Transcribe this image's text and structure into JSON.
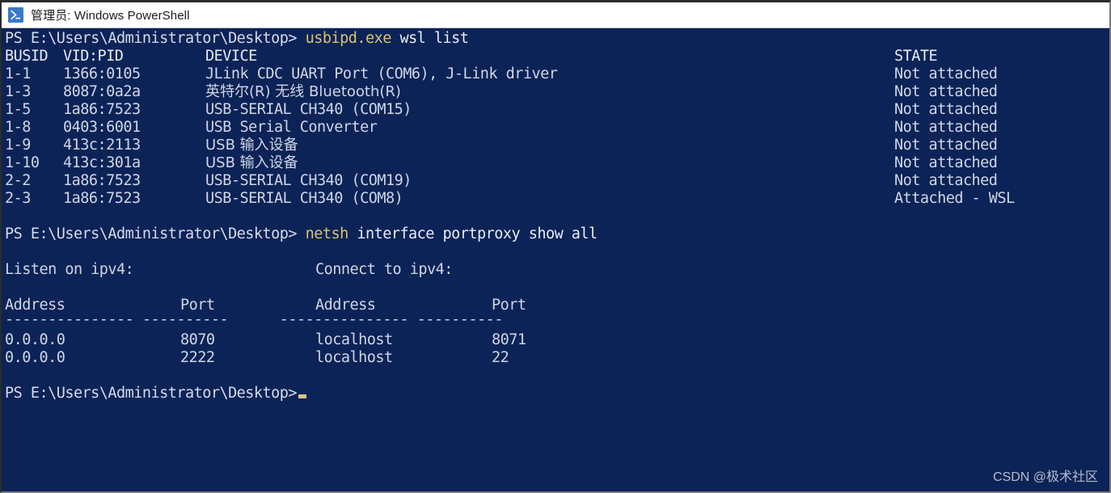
{
  "window": {
    "title": "管理员: Windows PowerShell",
    "icon": "powershell-icon",
    "background_color": "#0c2357",
    "titlebar_color": "#ffffff",
    "text_color": "#d6dbe8",
    "accent_color": "#d9c56a"
  },
  "terminal": {
    "prompt": "PS E:\\Users\\Administrator\\Desktop>",
    "commands": [
      {
        "name": "usbipd.exe",
        "args": " wsl list"
      },
      {
        "name": "netsh",
        "args": " interface portproxy show all"
      }
    ],
    "usbipd_table": {
      "headers": {
        "busid": "BUSID",
        "vidpid": "VID:PID",
        "device": "DEVICE",
        "state": "STATE"
      },
      "rows": [
        {
          "busid": "1-1",
          "vidpid": "1366:0105",
          "device": "JLink CDC UART Port (COM6), J-Link driver",
          "state": "Not attached"
        },
        {
          "busid": "1-3",
          "vidpid": "8087:0a2a",
          "device": "英特尔(R) 无线 Bluetooth(R)",
          "state": "Not attached"
        },
        {
          "busid": "1-5",
          "vidpid": "1a86:7523",
          "device": "USB-SERIAL CH340 (COM15)",
          "state": "Not attached"
        },
        {
          "busid": "1-8",
          "vidpid": "0403:6001",
          "device": "USB Serial Converter",
          "state": "Not attached"
        },
        {
          "busid": "1-9",
          "vidpid": "413c:2113",
          "device": "USB 输入设备",
          "state": "Not attached"
        },
        {
          "busid": "1-10",
          "vidpid": "413c:301a",
          "device": "USB 输入设备",
          "state": "Not attached"
        },
        {
          "busid": "2-2",
          "vidpid": "1a86:7523",
          "device": "USB-SERIAL CH340 (COM19)",
          "state": "Not attached"
        },
        {
          "busid": "2-3",
          "vidpid": "1a86:7523",
          "device": "USB-SERIAL CH340 (COM8)",
          "state": "Attached - WSL"
        }
      ]
    },
    "portproxy_table": {
      "listen_label": "Listen on ipv4:",
      "connect_label": "Connect to ipv4:",
      "headers": {
        "listen_address": "Address",
        "listen_port": "Port",
        "connect_address": "Address",
        "connect_port": "Port"
      },
      "separator": "--------------- ----------      --------------- ----------",
      "rows": [
        {
          "listen_address": "0.0.0.0",
          "listen_port": "8070",
          "connect_address": "localhost",
          "connect_port": "8071"
        },
        {
          "listen_address": "0.0.0.0",
          "listen_port": "2222",
          "connect_address": "localhost",
          "connect_port": "22"
        }
      ]
    },
    "cursor": "_"
  },
  "watermark": "CSDN @极术社区"
}
